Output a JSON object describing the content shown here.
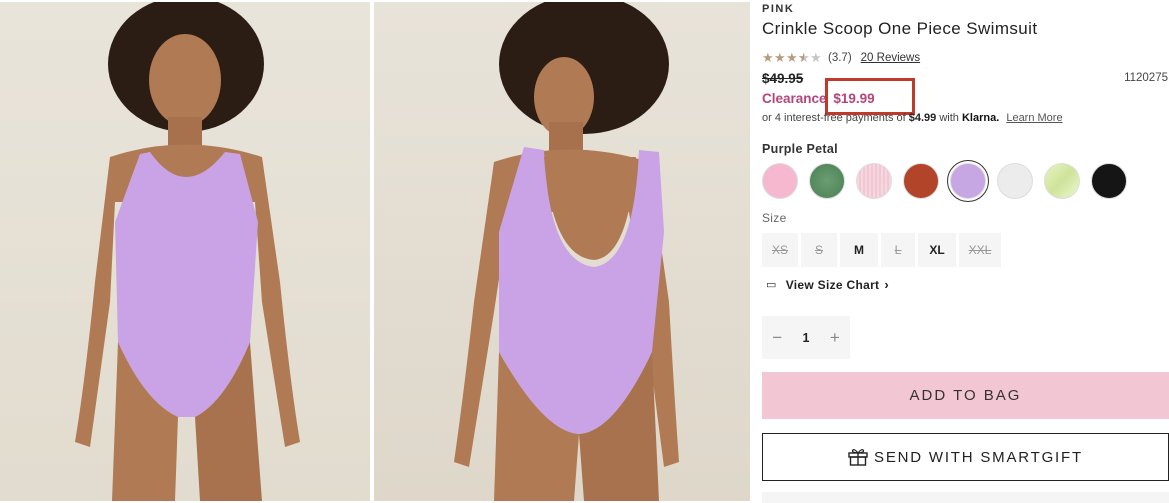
{
  "product": {
    "brand": "PINK",
    "title": "Crinkle Scoop One Piece Swimsuit",
    "rating": 3.7,
    "rating_text": "(3.7)",
    "reviews_text": "20 Reviews",
    "original_price": "$49.95",
    "sku": "1120275",
    "clearance_label": "Clearance",
    "clearance_price": "$19.99",
    "klarna": {
      "prefix": "or 4 interest-free payments of",
      "amount": "$4.99",
      "with": "with",
      "brand": "Klarna.",
      "learn_more": "Learn More"
    }
  },
  "color": {
    "selected_label": "Purple Petal",
    "swatches": [
      {
        "name": "pink",
        "hex": "#f6b8cf"
      },
      {
        "name": "green",
        "hex": "#4a7f54"
      },
      {
        "name": "light-pink",
        "hex": "#f4d0da"
      },
      {
        "name": "rust",
        "hex": "#b24429"
      },
      {
        "name": "purple-petal",
        "hex": "#c6a6e3",
        "selected": true
      },
      {
        "name": "white",
        "hex": "#ececec"
      },
      {
        "name": "lime",
        "hex": "#dcecab"
      },
      {
        "name": "black",
        "hex": "#151515"
      }
    ]
  },
  "size": {
    "label": "Size",
    "options": [
      {
        "label": "XS",
        "available": false
      },
      {
        "label": "S",
        "available": false
      },
      {
        "label": "M",
        "available": true
      },
      {
        "label": "L",
        "available": false
      },
      {
        "label": "XL",
        "available": true
      },
      {
        "label": "XXL",
        "available": false
      }
    ],
    "chart_link": "View Size Chart",
    "chart_icon": "ruler-icon"
  },
  "quantity": {
    "minus": "−",
    "value": "1",
    "plus": "+"
  },
  "actions": {
    "add_to_bag": "ADD TO BAG",
    "smartgift": "SEND WITH SMARTGIFT",
    "smartgift_icon": "gift-icon"
  },
  "images": [
    {
      "name": "front-view",
      "swimsuit_color": "#c9a3e6"
    },
    {
      "name": "back-view",
      "swimsuit_color": "#c9a3e6"
    }
  ]
}
